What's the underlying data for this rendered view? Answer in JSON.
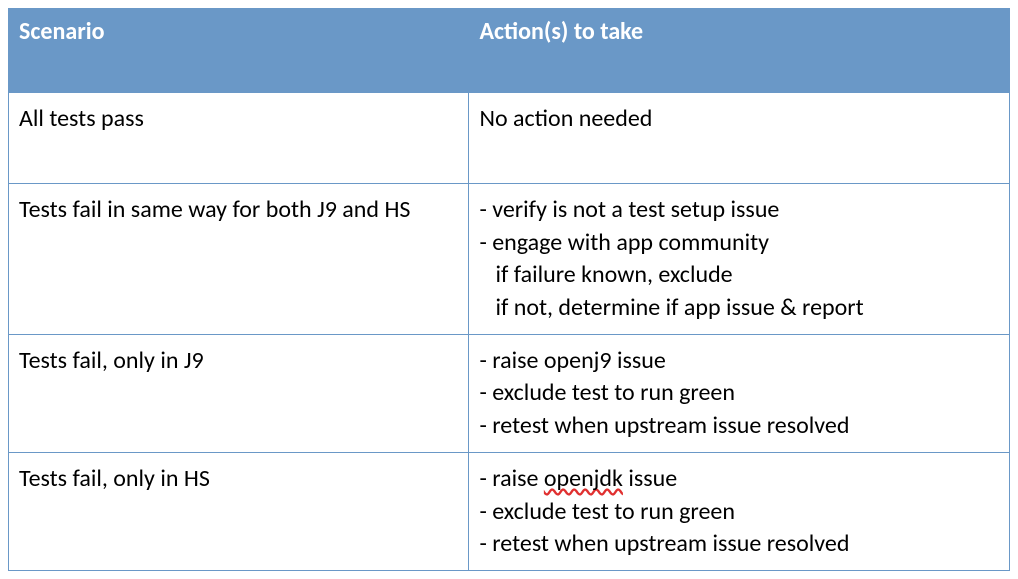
{
  "table": {
    "headers": {
      "scenario": "Scenario",
      "actions": "Action(s) to take"
    },
    "rows": [
      {
        "scenario": "All tests pass",
        "actions": [
          "No action needed"
        ]
      },
      {
        "scenario": "Tests fail in same way for both J9 and HS",
        "actions": [
          "- verify is not a test setup issue",
          "- engage with app community",
          "  if failure known, exclude",
          "  if not, determine if app issue & report"
        ]
      },
      {
        "scenario": "Tests fail, only in J9",
        "actions": [
          "- raise openj9 issue",
          "- exclude test to run green",
          "- retest when upstream issue resolved"
        ]
      },
      {
        "scenario": "Tests fail, only in HS",
        "actions_parts": [
          {
            "t": "- raise "
          },
          {
            "t": "openjdk",
            "squiggle": true
          },
          {
            "t": " issue",
            "br": true
          },
          {
            "t": "- exclude test to run green",
            "br": true
          },
          {
            "t": "- retest when upstream issue resolved"
          }
        ]
      }
    ]
  }
}
